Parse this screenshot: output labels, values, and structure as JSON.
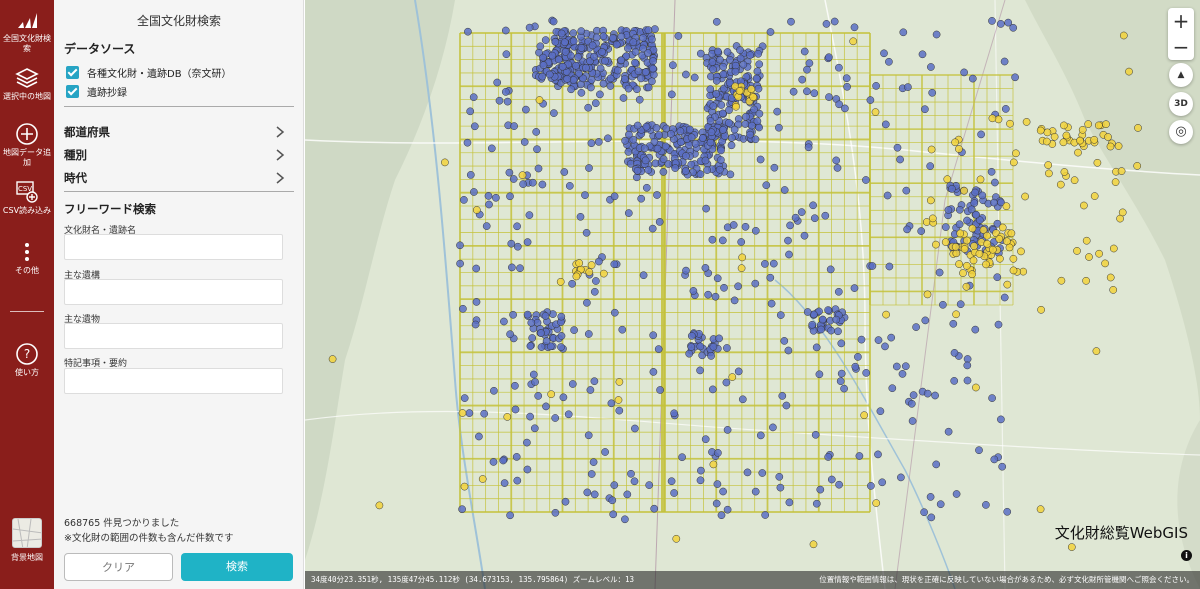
{
  "rail": {
    "items": [
      {
        "label": "全国文化財検索",
        "icon": "logo-icon"
      },
      {
        "label": "選択中の地図",
        "icon": "layers-icon"
      },
      {
        "label": "地図データ追加",
        "icon": "plus-circle-icon"
      },
      {
        "label": "CSV読み込み",
        "icon": "csv-icon"
      },
      {
        "label": "その他",
        "icon": "more-vertical-icon"
      },
      {
        "label": "使い方",
        "icon": "help-icon"
      }
    ],
    "base_map_label": "背景地図"
  },
  "panel": {
    "title": "全国文化財検索",
    "data_source": {
      "heading": "データソース",
      "options": [
        {
          "label": "各種文化財・遺跡DB（奈文研）",
          "checked": true
        },
        {
          "label": "遺跡抄録",
          "checked": true
        }
      ]
    },
    "filters": [
      {
        "label": "都道府県"
      },
      {
        "label": "種別"
      },
      {
        "label": "時代"
      }
    ],
    "freeword": {
      "heading": "フリーワード検索",
      "fields": [
        {
          "label": "文化財名・遺跡名",
          "value": ""
        },
        {
          "label": "主な遺構",
          "value": ""
        },
        {
          "label": "主な遺物",
          "value": ""
        },
        {
          "label": "特記事項・要約",
          "value": ""
        }
      ]
    },
    "result_count": "668765 件見つかりました",
    "result_note": "※文化財の範囲の件数も含んだ件数です",
    "clear_label": "クリア",
    "search_label": "検索"
  },
  "map": {
    "zoom_in": "+",
    "zoom_out": "−",
    "compass": "▲",
    "view_3d": "3D",
    "locate": "◎",
    "brand": "文化財総覧WebGIS",
    "info": "i",
    "coords": "34度40分23.351秒, 135度47分45.112秒 (34.673153, 135.795864) ズームレベル：13",
    "disclaimer": "位置情報や範囲情報は、現状を正確に反映していない場合があるため、必ず文化財所管機関へご照会ください。",
    "colors": {
      "grid": "#c4c23a",
      "blue_marker": "#5b6fc4",
      "yellow_marker": "#f2d23c"
    }
  }
}
